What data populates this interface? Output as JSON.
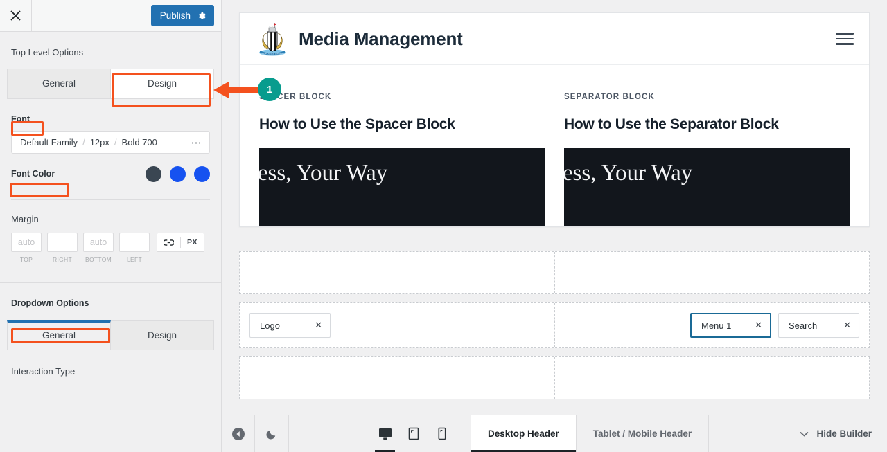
{
  "panel": {
    "close_icon": "close-icon",
    "publish_label": "Publish",
    "settings_icon": "gear-icon",
    "section_title": "Top Level Options",
    "top_tabs": [
      {
        "label": "General",
        "active": false
      },
      {
        "label": "Design",
        "active": true
      }
    ],
    "font": {
      "label": "Font",
      "family": "Default Family",
      "size": "12px",
      "weight": "Bold 700",
      "more_icon": "ellipsis-icon",
      "separator": "/"
    },
    "font_color": {
      "label": "Font Color",
      "swatches": [
        "#3a4652",
        "#1652f0",
        "#1652f0"
      ]
    },
    "margin": {
      "label": "Margin",
      "fields": [
        {
          "caption": "TOP",
          "value": "",
          "placeholder": "auto"
        },
        {
          "caption": "RIGHT",
          "value": "",
          "placeholder": ""
        },
        {
          "caption": "BOTTOM",
          "value": "",
          "placeholder": "auto"
        },
        {
          "caption": "LEFT",
          "value": "",
          "placeholder": ""
        }
      ],
      "link_icon": "link-icon",
      "unit": "PX"
    },
    "dropdown_options": {
      "label": "Dropdown Options",
      "tabs": [
        {
          "label": "General",
          "active": true
        },
        {
          "label": "Design",
          "active": false
        }
      ],
      "interaction_type_label": "Interaction Type"
    }
  },
  "callout": {
    "number": "1",
    "badge_color": "#089c8e",
    "arrow_color": "#f4511e",
    "highlight_color": "#f4511e"
  },
  "preview": {
    "site_title": "Media Management",
    "logo_icon": "heraldic-crest-logo",
    "menu_icon": "hamburger-menu-icon",
    "posts": [
      {
        "kicker": "SPACER BLOCK",
        "title": "How to Use the Spacer Block",
        "thumb_text": "dPress, Your Way"
      },
      {
        "kicker": "SEPARATOR BLOCK",
        "title": "How to Use the Separator Block",
        "thumb_text": "dPress, Your Way"
      }
    ]
  },
  "builder": {
    "rows": [
      {
        "left_items": [],
        "right_items": []
      },
      {
        "left_items": [
          {
            "label": "Logo",
            "selected": false,
            "remove_icon": "close-icon"
          }
        ],
        "right_items": [
          {
            "label": "Menu 1",
            "selected": true,
            "remove_icon": "close-icon"
          },
          {
            "label": "Search",
            "selected": false,
            "remove_icon": "close-icon"
          }
        ]
      },
      {
        "left_items": [],
        "right_items": []
      }
    ],
    "selected_border_color": "#1a6a96"
  },
  "bottom_bar": {
    "back_icon": "back-arrow-icon",
    "theme_icon": "moon-icon",
    "devices": [
      {
        "name": "desktop-view-icon",
        "active": true
      },
      {
        "name": "tablet-view-icon",
        "active": false
      },
      {
        "name": "mobile-view-icon",
        "active": false
      }
    ],
    "tabs": [
      {
        "label": "Desktop Header",
        "active": true
      },
      {
        "label": "Tablet / Mobile Header",
        "active": false
      }
    ],
    "hide_builder_label": "Hide Builder",
    "hide_builder_icon": "chevron-down-icon"
  }
}
